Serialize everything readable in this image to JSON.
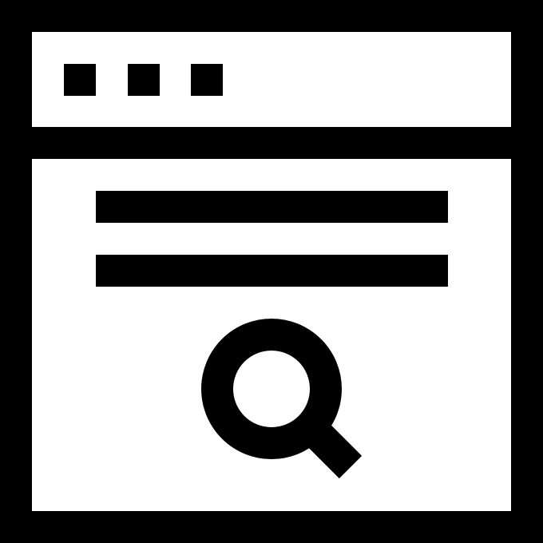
{
  "icon": {
    "name": "browser-search-icon",
    "stroke_color": "#000000",
    "fill_color": "#ffffff",
    "window_controls": [
      "control-dot",
      "control-dot",
      "control-dot"
    ],
    "content_lines": [
      "text-line",
      "text-line"
    ],
    "search_symbol": "magnifying-glass-icon"
  }
}
